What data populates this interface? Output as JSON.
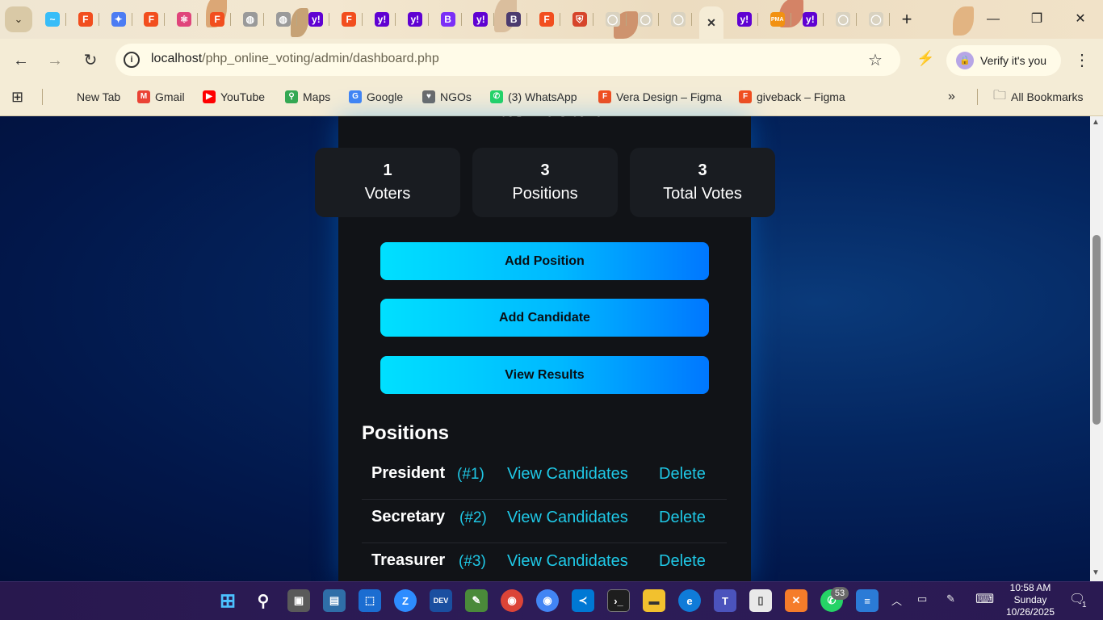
{
  "browser": {
    "url_host": "localhost",
    "url_path": "/php_online_voting/admin/dashboard.php",
    "verify_label": "Verify it's you",
    "tabs": [
      {
        "icon": "tailwind-icon",
        "color": "#38bdf8",
        "glyph": "~"
      },
      {
        "icon": "figma-icon",
        "color": "#f24e1e",
        "glyph": "F"
      },
      {
        "icon": "gemini-icon",
        "color": "#4c7cf3",
        "glyph": "✦"
      },
      {
        "icon": "figma-icon",
        "color": "#f24e1e",
        "glyph": "F"
      },
      {
        "icon": "react-icon",
        "color": "#e0457b",
        "glyph": "⚛"
      },
      {
        "icon": "figma-icon",
        "color": "#f24e1e",
        "glyph": "F"
      },
      {
        "icon": "globe-icon",
        "color": "#9a9a9a",
        "glyph": "◍"
      },
      {
        "icon": "globe-icon",
        "color": "#9a9a9a",
        "glyph": "◍"
      },
      {
        "icon": "yahoo-icon",
        "color": "#6001d2",
        "glyph": "y!"
      },
      {
        "icon": "figma-icon",
        "color": "#f24e1e",
        "glyph": "F"
      },
      {
        "icon": "yahoo-icon",
        "color": "#6001d2",
        "glyph": "y!"
      },
      {
        "icon": "yahoo-icon",
        "color": "#6001d2",
        "glyph": "y!"
      },
      {
        "icon": "bootstrap-icon",
        "color": "#7b2ff7",
        "glyph": "B"
      },
      {
        "icon": "yahoo-icon",
        "color": "#6001d2",
        "glyph": "y!"
      },
      {
        "icon": "bootstrap-icon",
        "color": "#4b3a6e",
        "glyph": "B"
      },
      {
        "icon": "figma-icon",
        "color": "#f24e1e",
        "glyph": "F"
      },
      {
        "icon": "shield-icon",
        "color": "#d6452b",
        "glyph": "⛨"
      },
      {
        "icon": "github-icon",
        "color": "#d9d2c0",
        "glyph": "◯"
      },
      {
        "icon": "github-icon",
        "color": "#d9d2c0",
        "glyph": "◯"
      },
      {
        "icon": "github-icon",
        "color": "#d9d2c0",
        "glyph": "◯"
      },
      {
        "icon": "close-icon",
        "color": "transparent",
        "glyph": "✕",
        "active": true
      },
      {
        "icon": "yahoo-icon",
        "color": "#6001d2",
        "glyph": "y!"
      },
      {
        "icon": "phpmyadmin-icon",
        "color": "#f29111",
        "glyph": "PMA"
      },
      {
        "icon": "yahoo-icon",
        "color": "#6001d2",
        "glyph": "y!"
      },
      {
        "icon": "github-icon",
        "color": "#d9d2c0",
        "glyph": "◯"
      },
      {
        "icon": "github-icon",
        "color": "#d9d2c0",
        "glyph": "◯"
      }
    ],
    "bookmarks": [
      {
        "label": "New Tab",
        "icon": "none",
        "color": "transparent",
        "glyph": ""
      },
      {
        "label": "Gmail",
        "icon": "gmail-icon",
        "color": "#ea4335",
        "glyph": "M"
      },
      {
        "label": "YouTube",
        "icon": "youtube-icon",
        "color": "#ff0000",
        "glyph": "▶"
      },
      {
        "label": "Maps",
        "icon": "maps-icon",
        "color": "#34a853",
        "glyph": "⚲"
      },
      {
        "label": "Google",
        "icon": "google-icon",
        "color": "#4285f4",
        "glyph": "G"
      },
      {
        "label": "NGOs",
        "icon": "heart-icon",
        "color": "#6b6b6b",
        "glyph": "♥"
      },
      {
        "label": "(3) WhatsApp",
        "icon": "whatsapp-icon",
        "color": "#25d366",
        "glyph": "✆"
      },
      {
        "label": "Vera Design – Figma",
        "icon": "figma-icon",
        "color": "#f24e1e",
        "glyph": "F"
      },
      {
        "label": "giveback – Figma",
        "icon": "figma-icon",
        "color": "#f24e1e",
        "glyph": "F"
      }
    ],
    "all_bookmarks_label": "All Bookmarks"
  },
  "dashboard": {
    "title": "Dashboard",
    "stats": [
      {
        "value": "1",
        "label": "Voters"
      },
      {
        "value": "3",
        "label": "Positions"
      },
      {
        "value": "3",
        "label": "Total Votes"
      }
    ],
    "actions": {
      "add_position": "Add Position",
      "add_candidate": "Add Candidate",
      "view_results": "View Results"
    },
    "positions_heading": "Positions",
    "positions": [
      {
        "name": "President",
        "id": "(#1)",
        "view": "View Candidates",
        "delete": "Delete"
      },
      {
        "name": "Secretary",
        "id": "(#2)",
        "view": "View Candidates",
        "delete": "Delete"
      },
      {
        "name": "Treasurer",
        "id": "(#3)",
        "view": "View Candidates",
        "delete": "Delete"
      }
    ]
  },
  "taskbar": {
    "time": "10:58 AM",
    "day": "Sunday",
    "date": "10/26/2025",
    "whatsapp_badge": "53",
    "notifications": "1"
  }
}
